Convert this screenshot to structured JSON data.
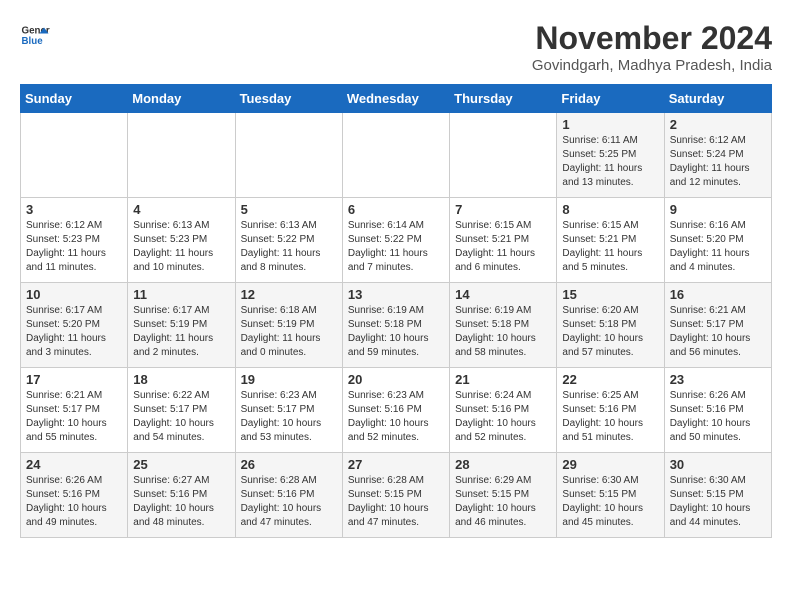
{
  "logo": {
    "line1": "General",
    "line2": "Blue"
  },
  "title": "November 2024",
  "subtitle": "Govindgarh, Madhya Pradesh, India",
  "headers": [
    "Sunday",
    "Monday",
    "Tuesday",
    "Wednesday",
    "Thursday",
    "Friday",
    "Saturday"
  ],
  "weeks": [
    [
      {
        "day": "",
        "info": ""
      },
      {
        "day": "",
        "info": ""
      },
      {
        "day": "",
        "info": ""
      },
      {
        "day": "",
        "info": ""
      },
      {
        "day": "",
        "info": ""
      },
      {
        "day": "1",
        "info": "Sunrise: 6:11 AM\nSunset: 5:25 PM\nDaylight: 11 hours and 13 minutes."
      },
      {
        "day": "2",
        "info": "Sunrise: 6:12 AM\nSunset: 5:24 PM\nDaylight: 11 hours and 12 minutes."
      }
    ],
    [
      {
        "day": "3",
        "info": "Sunrise: 6:12 AM\nSunset: 5:23 PM\nDaylight: 11 hours and 11 minutes."
      },
      {
        "day": "4",
        "info": "Sunrise: 6:13 AM\nSunset: 5:23 PM\nDaylight: 11 hours and 10 minutes."
      },
      {
        "day": "5",
        "info": "Sunrise: 6:13 AM\nSunset: 5:22 PM\nDaylight: 11 hours and 8 minutes."
      },
      {
        "day": "6",
        "info": "Sunrise: 6:14 AM\nSunset: 5:22 PM\nDaylight: 11 hours and 7 minutes."
      },
      {
        "day": "7",
        "info": "Sunrise: 6:15 AM\nSunset: 5:21 PM\nDaylight: 11 hours and 6 minutes."
      },
      {
        "day": "8",
        "info": "Sunrise: 6:15 AM\nSunset: 5:21 PM\nDaylight: 11 hours and 5 minutes."
      },
      {
        "day": "9",
        "info": "Sunrise: 6:16 AM\nSunset: 5:20 PM\nDaylight: 11 hours and 4 minutes."
      }
    ],
    [
      {
        "day": "10",
        "info": "Sunrise: 6:17 AM\nSunset: 5:20 PM\nDaylight: 11 hours and 3 minutes."
      },
      {
        "day": "11",
        "info": "Sunrise: 6:17 AM\nSunset: 5:19 PM\nDaylight: 11 hours and 2 minutes."
      },
      {
        "day": "12",
        "info": "Sunrise: 6:18 AM\nSunset: 5:19 PM\nDaylight: 11 hours and 0 minutes."
      },
      {
        "day": "13",
        "info": "Sunrise: 6:19 AM\nSunset: 5:18 PM\nDaylight: 10 hours and 59 minutes."
      },
      {
        "day": "14",
        "info": "Sunrise: 6:19 AM\nSunset: 5:18 PM\nDaylight: 10 hours and 58 minutes."
      },
      {
        "day": "15",
        "info": "Sunrise: 6:20 AM\nSunset: 5:18 PM\nDaylight: 10 hours and 57 minutes."
      },
      {
        "day": "16",
        "info": "Sunrise: 6:21 AM\nSunset: 5:17 PM\nDaylight: 10 hours and 56 minutes."
      }
    ],
    [
      {
        "day": "17",
        "info": "Sunrise: 6:21 AM\nSunset: 5:17 PM\nDaylight: 10 hours and 55 minutes."
      },
      {
        "day": "18",
        "info": "Sunrise: 6:22 AM\nSunset: 5:17 PM\nDaylight: 10 hours and 54 minutes."
      },
      {
        "day": "19",
        "info": "Sunrise: 6:23 AM\nSunset: 5:17 PM\nDaylight: 10 hours and 53 minutes."
      },
      {
        "day": "20",
        "info": "Sunrise: 6:23 AM\nSunset: 5:16 PM\nDaylight: 10 hours and 52 minutes."
      },
      {
        "day": "21",
        "info": "Sunrise: 6:24 AM\nSunset: 5:16 PM\nDaylight: 10 hours and 52 minutes."
      },
      {
        "day": "22",
        "info": "Sunrise: 6:25 AM\nSunset: 5:16 PM\nDaylight: 10 hours and 51 minutes."
      },
      {
        "day": "23",
        "info": "Sunrise: 6:26 AM\nSunset: 5:16 PM\nDaylight: 10 hours and 50 minutes."
      }
    ],
    [
      {
        "day": "24",
        "info": "Sunrise: 6:26 AM\nSunset: 5:16 PM\nDaylight: 10 hours and 49 minutes."
      },
      {
        "day": "25",
        "info": "Sunrise: 6:27 AM\nSunset: 5:16 PM\nDaylight: 10 hours and 48 minutes."
      },
      {
        "day": "26",
        "info": "Sunrise: 6:28 AM\nSunset: 5:16 PM\nDaylight: 10 hours and 47 minutes."
      },
      {
        "day": "27",
        "info": "Sunrise: 6:28 AM\nSunset: 5:15 PM\nDaylight: 10 hours and 47 minutes."
      },
      {
        "day": "28",
        "info": "Sunrise: 6:29 AM\nSunset: 5:15 PM\nDaylight: 10 hours and 46 minutes."
      },
      {
        "day": "29",
        "info": "Sunrise: 6:30 AM\nSunset: 5:15 PM\nDaylight: 10 hours and 45 minutes."
      },
      {
        "day": "30",
        "info": "Sunrise: 6:30 AM\nSunset: 5:15 PM\nDaylight: 10 hours and 44 minutes."
      }
    ]
  ]
}
